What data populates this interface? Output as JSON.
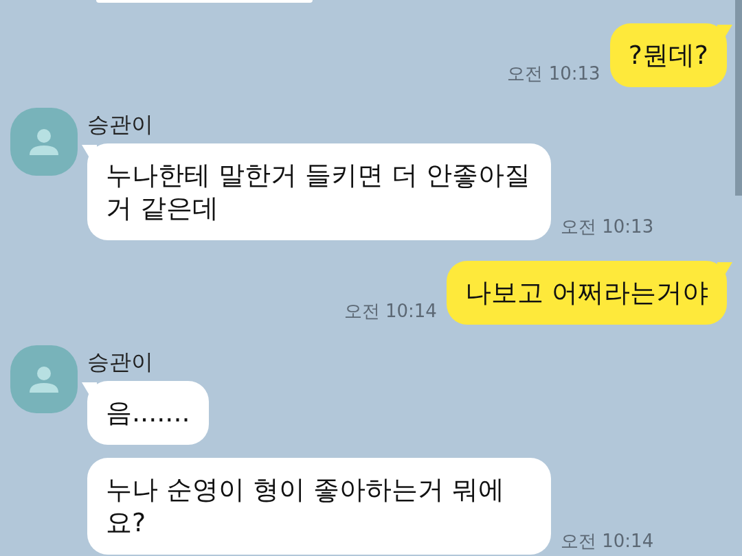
{
  "messages": [
    {
      "kind": "cut_off"
    },
    {
      "kind": "sent",
      "text": "?뭔데?",
      "time": "오전 10:13"
    },
    {
      "kind": "received",
      "sender": "승관이",
      "bubbles": [
        "누나한테 말한거 들키면 더 안좋아질거 같은데"
      ],
      "time": "오전 10:13"
    },
    {
      "kind": "sent",
      "text": "나보고 어쩌라는거야",
      "time": "오전 10:14"
    },
    {
      "kind": "received",
      "sender": "승관이",
      "bubbles": [
        "음.......",
        "누나 순영이 형이 좋아하는거 뭐에요?"
      ],
      "time": "오전 10:14"
    }
  ]
}
